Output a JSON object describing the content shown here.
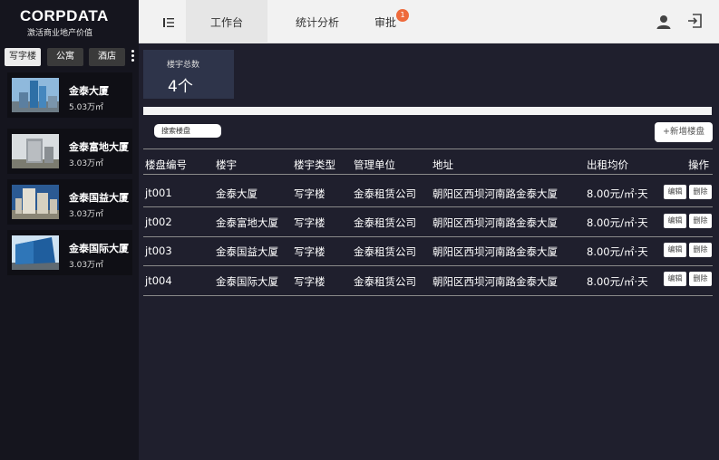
{
  "brand": {
    "name": "CORPDATA",
    "slogan": "激活商业地产价值"
  },
  "side_tabs": [
    "写字楼",
    "公寓",
    "酒店"
  ],
  "buildings": [
    {
      "name": "金泰大厦",
      "area": "5.03万㎡"
    },
    {
      "name": "金泰富地大厦",
      "area": "3.03万㎡"
    },
    {
      "name": "金泰国益大厦",
      "area": "3.03万㎡"
    },
    {
      "name": "金泰国际大厦",
      "area": "3.03万㎡"
    }
  ],
  "nav": {
    "tabs": [
      "工作台",
      "统计分析",
      "审批"
    ],
    "badge": "1"
  },
  "stat": {
    "label": "楼宇总数",
    "value": "4个"
  },
  "search": {
    "placeholder": "搜索楼盘"
  },
  "add_button": "+新增楼盘",
  "table": {
    "headers": [
      "楼盘编号",
      "楼宇",
      "楼宇类型",
      "管理单位",
      "地址",
      "出租均价",
      "操作"
    ],
    "rows": [
      {
        "id": "jt001",
        "building": "金泰大厦",
        "type": "写字楼",
        "manager": "金泰租赁公司",
        "address": "朝阳区西坝河南路金泰大厦",
        "price": "8.00元/㎡·天"
      },
      {
        "id": "jt002",
        "building": "金泰富地大厦",
        "type": "写字楼",
        "manager": "金泰租赁公司",
        "address": "朝阳区西坝河南路金泰大厦",
        "price": "8.00元/㎡·天"
      },
      {
        "id": "jt003",
        "building": "金泰国益大厦",
        "type": "写字楼",
        "manager": "金泰租赁公司",
        "address": "朝阳区西坝河南路金泰大厦",
        "price": "8.00元/㎡·天"
      },
      {
        "id": "jt004",
        "building": "金泰国际大厦",
        "type": "写字楼",
        "manager": "金泰租赁公司",
        "address": "朝阳区西坝河南路金泰大厦",
        "price": "8.00元/㎡·天"
      }
    ],
    "actions": {
      "edit": "编辑",
      "delete": "删除"
    }
  },
  "colors": {
    "background": "#1f1f2d",
    "sidebar": "#15151e",
    "stat_card": "#2e344a",
    "badge": "#ee6a3c"
  },
  "icons": [
    "menu-icon",
    "user-icon",
    "logout-icon",
    "more-icon"
  ]
}
